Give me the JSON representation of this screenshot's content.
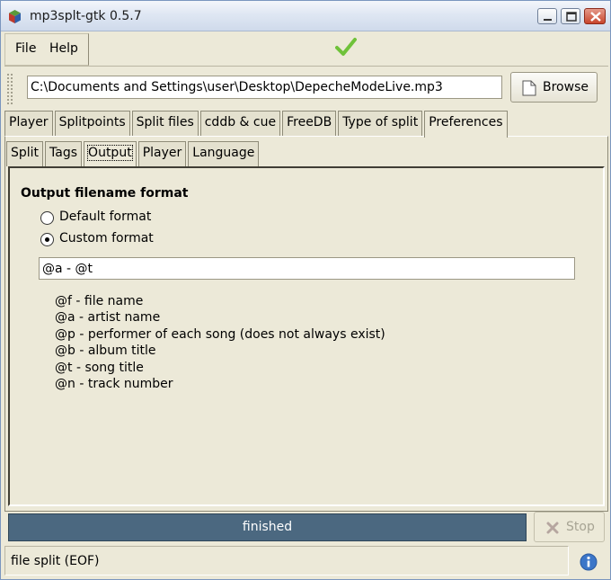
{
  "window": {
    "title": "mp3splt-gtk 0.5.7"
  },
  "menu": {
    "file": "File",
    "help": "Help"
  },
  "file_row": {
    "path": "C:\\Documents and Settings\\user\\Desktop\\DepecheModeLive.mp3",
    "browse_label": "Browse"
  },
  "main_tabs": [
    "Player",
    "Splitpoints",
    "Split files",
    "cddb & cue",
    "FreeDB",
    "Type of split",
    "Preferences"
  ],
  "main_tab_active": "Preferences",
  "sub_tabs": [
    "Split",
    "Tags",
    "Output",
    "Player",
    "Language"
  ],
  "sub_tab_active": "Output",
  "output": {
    "section_title": "Output filename format",
    "options": [
      {
        "label": "Default format",
        "checked": false
      },
      {
        "label": "Custom format",
        "checked": true
      }
    ],
    "format_value": "@a - @t",
    "legend": [
      "@f - file name",
      "@a - artist name",
      "@p - performer of each song (does not always exist)",
      "@b - album title",
      "@t - song title",
      "@n - track number"
    ]
  },
  "progress": {
    "text": "finished",
    "fraction": 1.0
  },
  "stop_label": "Stop",
  "status": {
    "text": "file split (EOF)"
  },
  "icons": [
    "app-icon",
    "checkmark-icon",
    "minimize-icon",
    "maximize-icon",
    "close-icon",
    "document-icon",
    "stop-icon",
    "info-icon"
  ],
  "colors": {
    "progress_bg": "#4b6880",
    "check": "#6fc23a",
    "info": "#3c76c8"
  }
}
